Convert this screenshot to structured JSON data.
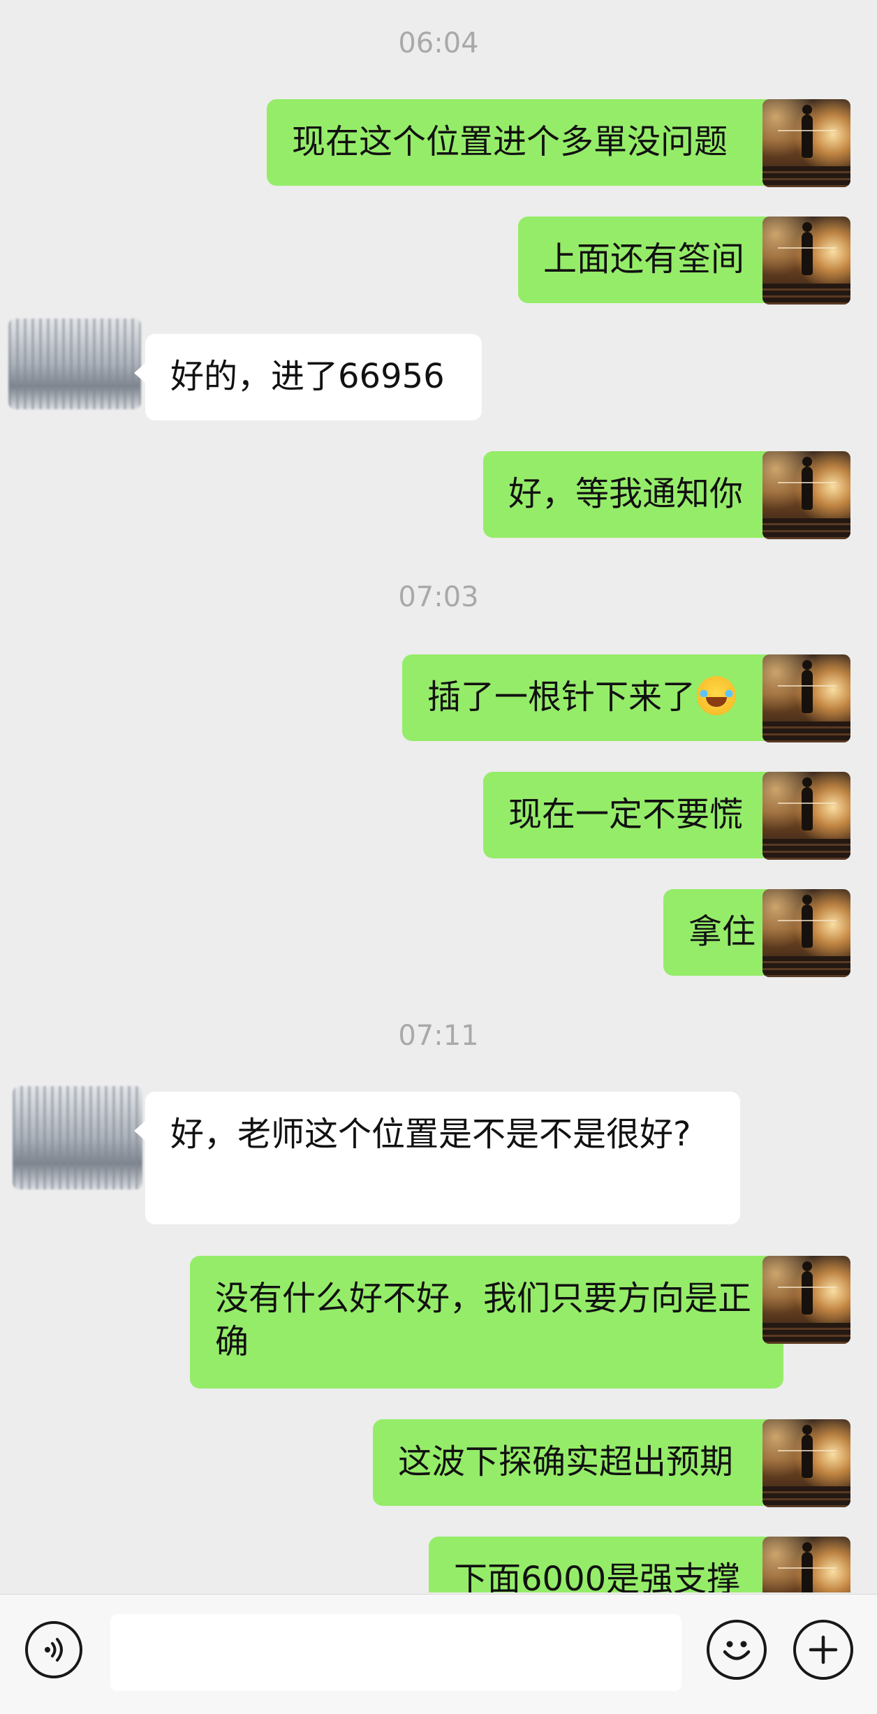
{
  "timestamps": [
    "06:04",
    "07:03",
    "07:11"
  ],
  "messages": [
    {
      "side": "me",
      "text": "现在这个位置进个多單没问题"
    },
    {
      "side": "me",
      "text": "上面还有筌间"
    },
    {
      "side": "other",
      "text": "好的，进了66956"
    },
    {
      "side": "me",
      "text": "好，等我通知你"
    },
    {
      "side": "me",
      "text": "插了一根针下来了",
      "emoji": "laughing-crying-emoji"
    },
    {
      "side": "me",
      "text": "现在一定不要慌"
    },
    {
      "side": "me",
      "text": "拿住"
    },
    {
      "side": "other",
      "text": "好，老师这个位置是不是不是很好?"
    },
    {
      "side": "me",
      "text": "没有什么好不好，我们只要方向是正确"
    },
    {
      "side": "me",
      "text": "这波下探确实超出预期"
    },
    {
      "side": "me",
      "text": "下面6000是强支撑"
    }
  ],
  "input_bar": {
    "text_value": "",
    "icons": [
      "voice-icon",
      "emoji-icon",
      "plus-icon"
    ]
  },
  "colors": {
    "background": "#ededed",
    "my_bubble": "#95ec69",
    "their_bubble": "#ffffff",
    "timestamp": "#a9a9a9"
  }
}
